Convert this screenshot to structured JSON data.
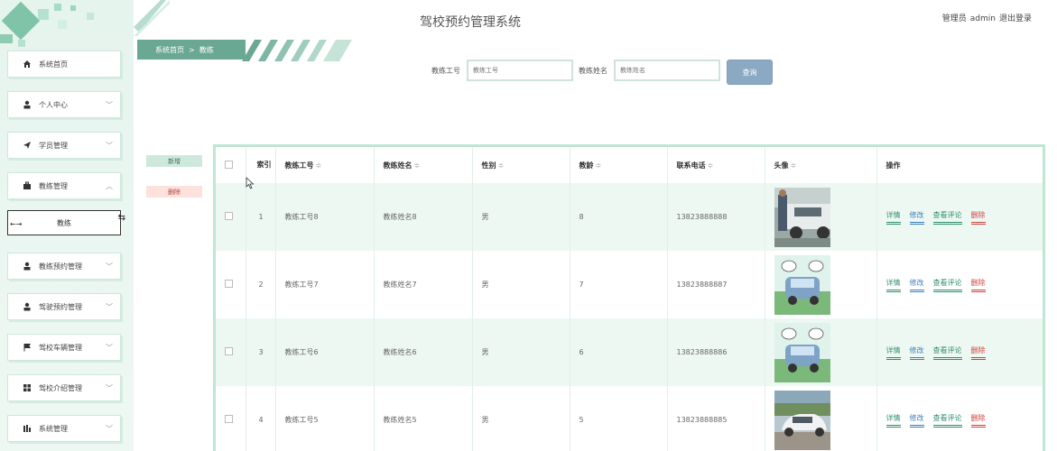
{
  "header": {
    "title": "驾校预约管理系统",
    "user_role": "管理员",
    "username": "admin",
    "logout": "退出登录"
  },
  "breadcrumb": {
    "home": "系统首页",
    "separator": ">",
    "current": "教练"
  },
  "sidebar": {
    "items": [
      {
        "label": "系统首页",
        "icon": "home-icon"
      },
      {
        "label": "个人中心",
        "icon": "user-icon",
        "chevron": "﹀"
      },
      {
        "label": "学员管理",
        "icon": "send-icon",
        "chevron": "﹀"
      },
      {
        "label": "教练管理",
        "icon": "briefcase-icon",
        "chevron": "︿"
      },
      {
        "label": "教练预约管理",
        "icon": "user-icon",
        "chevron": "﹀"
      },
      {
        "label": "驾驶预约管理",
        "icon": "user-icon",
        "chevron": "﹀"
      },
      {
        "label": "驾校车辆管理",
        "icon": "flag-icon",
        "chevron": "﹀"
      },
      {
        "label": "驾校介绍管理",
        "icon": "grid-icon",
        "chevron": "﹀"
      },
      {
        "label": "系统管理",
        "icon": "chart-icon",
        "chevron": "﹀"
      }
    ],
    "sub_item": "教练"
  },
  "search": {
    "coach_no_label": "教练工号",
    "coach_no_placeholder": "教练工号",
    "coach_name_label": "教练姓名",
    "coach_name_placeholder": "教练姓名",
    "button": "查询"
  },
  "actions": {
    "add": "新增",
    "delete": "删除"
  },
  "table": {
    "headers": {
      "index": "索引",
      "coach_no": "教练工号",
      "coach_name": "教练姓名",
      "gender": "性别",
      "age": "教龄",
      "phone": "联系电话",
      "avatar": "头像",
      "ops": "操作"
    },
    "sort_glyph": "≑",
    "ops": {
      "detail": "详情",
      "edit": "修改",
      "comment": "查看评论",
      "delete": "删除"
    },
    "rows": [
      {
        "index": "1",
        "coach_no": "教练工号8",
        "coach_name": "教练姓名8",
        "gender": "男",
        "age": "8",
        "phone": "13823888888",
        "avatar": "photo-man-with-car"
      },
      {
        "index": "2",
        "coach_no": "教练工号7",
        "coach_name": "教练姓名7",
        "gender": "男",
        "age": "7",
        "phone": "13823888887",
        "avatar": "cartoon-car"
      },
      {
        "index": "3",
        "coach_no": "教练工号6",
        "coach_name": "教练姓名6",
        "gender": "男",
        "age": "6",
        "phone": "13823888886",
        "avatar": "cartoon-car"
      },
      {
        "index": "4",
        "coach_no": "教练工号5",
        "coach_name": "教练姓名5",
        "gender": "男",
        "age": "5",
        "phone": "13823888885",
        "avatar": "photo-white-car"
      }
    ]
  }
}
